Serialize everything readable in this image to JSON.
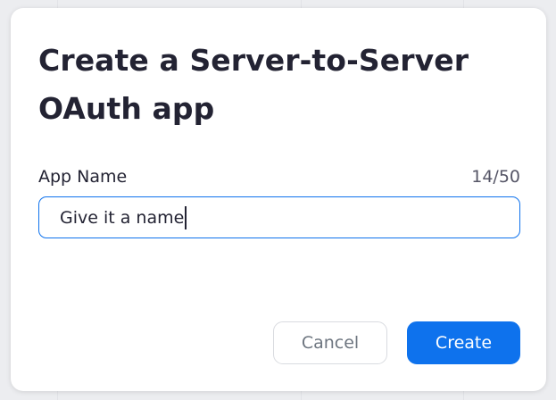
{
  "dialog": {
    "title": "Create a Server-to-Server OAuth app",
    "field": {
      "label": "App Name",
      "counter": "14/50",
      "value": "Give it a name",
      "max_length": 50
    },
    "buttons": {
      "cancel_label": "Cancel",
      "create_label": "Create"
    }
  },
  "colors": {
    "accent": "#0e72ed",
    "text_primary": "#232333",
    "backdrop": "#ecedf0"
  }
}
